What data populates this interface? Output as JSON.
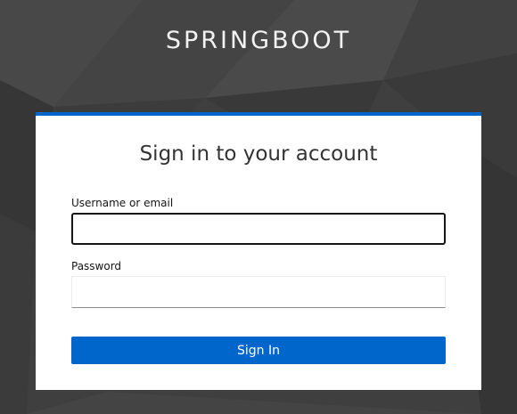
{
  "realm": {
    "title": "SPRINGBOOT"
  },
  "login": {
    "heading": "Sign in to your account",
    "username_label": "Username or email",
    "username_value": "",
    "password_label": "Password",
    "password_value": "",
    "submit_label": "Sign In"
  },
  "colors": {
    "accent": "#0066cc",
    "background": "#3e3e3e",
    "card": "#ffffff"
  }
}
